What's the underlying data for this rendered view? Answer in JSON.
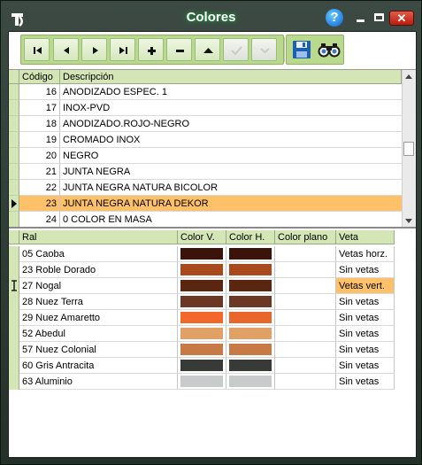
{
  "window": {
    "title": "Colores"
  },
  "toolbar": {
    "buttons": [
      {
        "name": "first-record-button",
        "icon": "first-icon"
      },
      {
        "name": "prior-record-button",
        "icon": "prior-icon"
      },
      {
        "name": "next-record-button",
        "icon": "next-icon"
      },
      {
        "name": "last-record-button",
        "icon": "last-icon"
      },
      {
        "name": "insert-record-button",
        "icon": "plus-icon"
      },
      {
        "name": "delete-record-button",
        "icon": "minus-icon"
      },
      {
        "name": "edit-record-button",
        "icon": "up-icon"
      },
      {
        "name": "post-record-button",
        "icon": "check-icon",
        "disabled": true
      },
      {
        "name": "cancel-record-button",
        "icon": "cancel-icon",
        "disabled": true
      }
    ],
    "save_icon": "save-icon",
    "search_icon": "binoculars-icon"
  },
  "colores": {
    "columns": {
      "code": "Código",
      "description": "Descripción"
    },
    "rows": [
      {
        "code": "16",
        "description": "ANODIZADO ESPEC. 1"
      },
      {
        "code": "17",
        "description": "INOX-PVD"
      },
      {
        "code": "18",
        "description": "ANODIZADO.ROJO-NEGRO"
      },
      {
        "code": "19",
        "description": "CROMADO INOX"
      },
      {
        "code": "20",
        "description": "NEGRO"
      },
      {
        "code": "21",
        "description": "JUNTA NEGRA"
      },
      {
        "code": "22",
        "description": "JUNTA NEGRA NATURA BICOLOR"
      },
      {
        "code": "23",
        "description": "JUNTA NEGRA NATURA DEKOR",
        "selected": true
      },
      {
        "code": "24",
        "description": "0 COLOR EN MASA"
      }
    ]
  },
  "rales": {
    "columns": {
      "ral": "Ral",
      "color_v": "Color V.",
      "color_h": "Color H.",
      "color_plano": "Color plano",
      "veta": "Veta"
    },
    "rows": [
      {
        "ral": "05 Caoba",
        "color_v": "#3b130b",
        "color_h": "#3b130b",
        "veta": "Vetas horz."
      },
      {
        "ral": "23 Roble Dorado",
        "color_v": "#a8491e",
        "color_h": "#a8491e",
        "veta": "Sin vetas"
      },
      {
        "ral": "27 Nogal",
        "color_v": "#5a2610",
        "color_h": "#5a2610",
        "veta": "Vetas vert.",
        "selected": true
      },
      {
        "ral": "28 Nuez Terra",
        "color_v": "#6b3826",
        "color_h": "#6b3826",
        "veta": "Sin vetas"
      },
      {
        "ral": "29 Nuez Amaretto",
        "color_v": "#f2672a",
        "color_h": "#e8652b",
        "veta": "Sin vetas"
      },
      {
        "ral": "52 Abedul",
        "color_v": "#e0a066",
        "color_h": "#e0a066",
        "veta": "Sin vetas"
      },
      {
        "ral": "57 Nuez Colonial",
        "color_v": "#c77a45",
        "color_h": "#c77a45",
        "veta": "Sin vetas"
      },
      {
        "ral": "60 Gris Antracita",
        "color_v": "#383a38",
        "color_h": "#383a38",
        "veta": "Sin vetas"
      },
      {
        "ral": "63 Aluminio",
        "color_v": "#c8cbc9",
        "color_h": "#c8cbc9",
        "veta": "Sin vetas"
      }
    ]
  }
}
